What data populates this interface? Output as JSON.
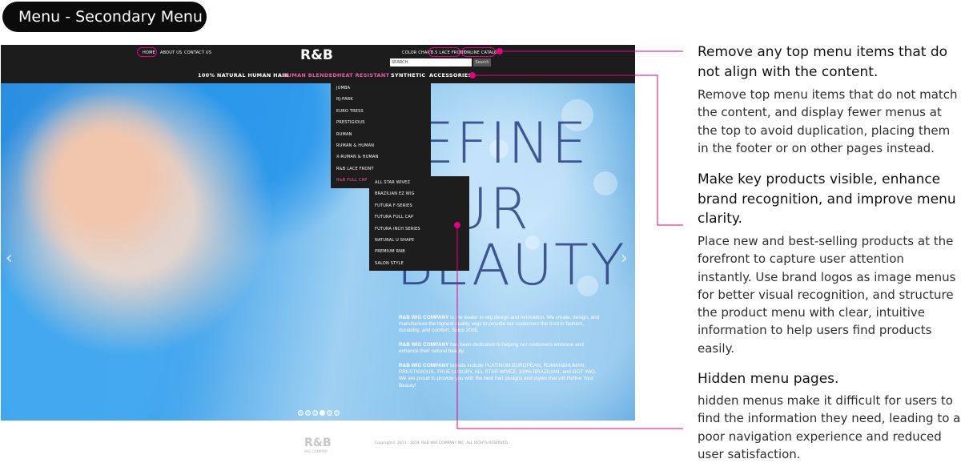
{
  "header": {
    "title": "Menu - Secondary Menu"
  },
  "site": {
    "top_nav": {
      "home": "HOME",
      "about": "ABOUT US",
      "contact": "CONTACT US"
    },
    "logo": "R&B",
    "right_links": {
      "color_chart": "COLOR CHART",
      "lace_front": "3.5 LACE FRONT",
      "online_catalog": "ONLINE CATALOG"
    },
    "search": {
      "placeholder": "SEARCH",
      "button": "Search"
    },
    "main_nav": [
      "100% NATURAL HUMAN HAIR",
      "HUMAN BLENDED",
      "HEAT RESISTANT",
      "SYNTHETIC",
      "ACCESSORIES"
    ],
    "dropdown_primary": [
      "JUMBA",
      "RJ-PARK",
      "EURO TRESS",
      "PRESTIGIOUS",
      "RUMAN",
      "RUMAN & HUMAN",
      "X-RUMAN & HUMAN",
      "R&B LACE FRONT",
      "R&B FULL CAP"
    ],
    "dropdown_secondary": [
      "ALL STAR WIVEZ",
      "BRAZILIAN EZ WIG",
      "FUTURA F-SERIES",
      "FUTURA FULL CAP",
      "FUTURA INCH SERIES",
      "NATURAL U SHAPE",
      "PREMIUM RNB",
      "SALON STYLE"
    ],
    "hero_words": {
      "line1": "EFINE",
      "line2": "OUR",
      "line3": "BEAUTY"
    },
    "body": {
      "p1_bold": "R&B WIG COMPANY",
      "p1": " is the leader in wig design and innovation. We create, design, and manufacture the highest quality wigs to provide our customers the best in fashion, durability, and comfort. Since 2006,",
      "p2_bold": "R&B WIG COMPANY",
      "p2": " has been dedicated to helping our customers embrace and enhance their natural beauty.",
      "p3_bold": "R&B WIG COMPANY",
      "p3": " brands include PLATINUM EUROPEAN, RUMAN&HUMAN, PRESTIGIOUS, TRUE LUXURY, ALL STAR WIVEZ, 100% BRAZILIAN, and GOT WIG. We are proud to provide you with the best hair designs and styles that will Refine Your Beauty!"
    },
    "arrows": {
      "left": "‹",
      "right": "›"
    },
    "footer": {
      "logo": "R&B",
      "logo_sub": "WIG COMPANY",
      "copyright": "Copyright© 2013 - 2019. R&B WIG COMPANY INC. ALL RIGHTS RESERVED"
    }
  },
  "annotations": [
    {
      "title": "Remove any top menu items that do not align with the content.",
      "body": "Remove top menu items that do not match the content, and display fewer menus at the top to avoid duplication, placing them in the footer or on other pages instead."
    },
    {
      "title": "Make key products visible, enhance brand recognition, and improve menu clarity.",
      "body": "Place new and best-selling products at the forefront to capture user attention instantly. Use brand logos as image menus for better visual recognition, and structure the product menu with clear, intuitive information to help users find products easily."
    },
    {
      "title": "Hidden menu pages.",
      "body": "hidden menus make it difficult for users to find the information they need, leading to a poor navigation experience and reduced user satisfaction."
    }
  ],
  "colors": {
    "accent": "#e6007e",
    "nav_active": "#e85ea5",
    "topbar": "#1c1c1c"
  }
}
